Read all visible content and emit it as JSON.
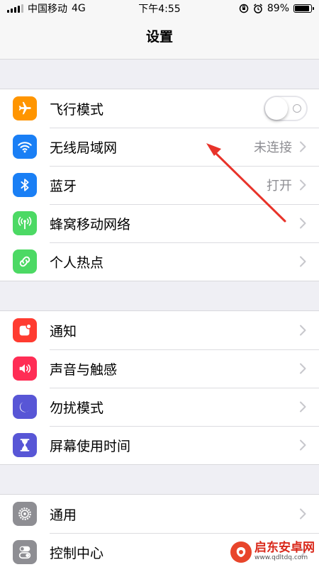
{
  "status_bar": {
    "carrier": "中国移动",
    "network": "4G",
    "time": "下午4:55",
    "battery_text": "89%",
    "battery_level": 0.89
  },
  "nav": {
    "title": "设置"
  },
  "groups": [
    [
      {
        "label": "飞行模式",
        "icon": "airplane-icon",
        "color": "#ff9500",
        "toggle": "off"
      },
      {
        "label": "无线局域网",
        "icon": "wifi-icon",
        "color": "#1a7ff5",
        "value": "未连接"
      },
      {
        "label": "蓝牙",
        "icon": "bluetooth-icon",
        "color": "#1a7ff5",
        "value": "打开"
      },
      {
        "label": "蜂窝移动网络",
        "icon": "cellular-antenna-icon",
        "color": "#4cd964"
      },
      {
        "label": "个人热点",
        "icon": "hotspot-chain-icon",
        "color": "#4cd964"
      }
    ],
    [
      {
        "label": "通知",
        "icon": "notification-icon",
        "color": "#ff3b30"
      },
      {
        "label": "声音与触感",
        "icon": "speaker-icon",
        "color": "#ff2d55"
      },
      {
        "label": "勿扰模式",
        "icon": "moon-icon",
        "color": "#5856d6"
      },
      {
        "label": "屏幕使用时间",
        "icon": "hourglass-icon",
        "color": "#5856d6"
      }
    ],
    [
      {
        "label": "通用",
        "icon": "gear-icon",
        "color": "#8e8e93"
      },
      {
        "label": "控制中心",
        "icon": "switches-icon",
        "color": "#8e8e93"
      }
    ]
  ],
  "watermark": {
    "title": "启东安卓网",
    "url": "www.qdltdq.com"
  },
  "colors": {
    "chevron": "#c7c7cc",
    "annotation": "#e8332a"
  }
}
